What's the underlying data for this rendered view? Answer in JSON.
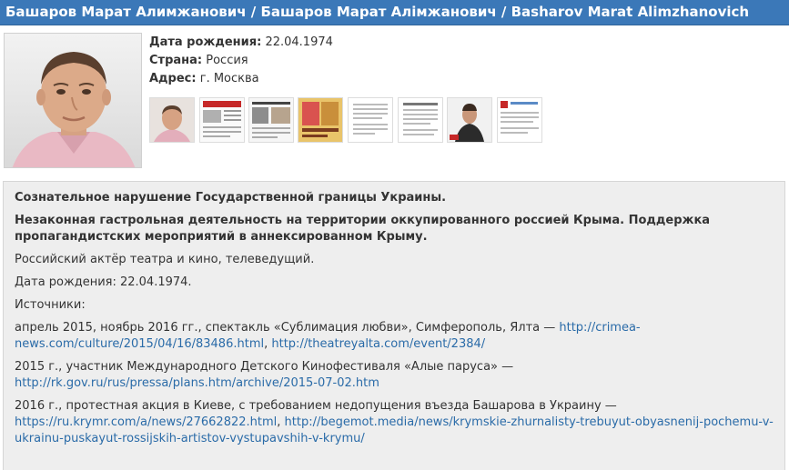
{
  "header": {
    "title": "Башаров Марат Алимжанович / Башаров Марат Алімжанович / Basharov Marat Alimzhanovich"
  },
  "profile": {
    "birth_label": "Дата рождения:",
    "birth_value": "22.04.1974",
    "country_label": "Страна:",
    "country_value": "Россия",
    "address_label": "Адрес:",
    "address_value": "г. Москва"
  },
  "thumbnails_count": 8,
  "details": {
    "violation": "Сознательное нарушение Государственной границы Украины.",
    "activity": "Незаконная гастрольная деятельность на территории оккупированного россией Крыма. Поддержка пропагандистских мероприятий в аннексированном Крыму.",
    "description": "Российский актёр театра и кино, телеведущий.",
    "birth": "Дата рождения: 22.04.1974.",
    "sources_label": "Источники:",
    "source1_text": "апрель 2015, ноябрь 2016 гг., спектакль «Сублимация любви», Симферополь, Ялта — ",
    "source1_link1": "http://crimea-news.com/culture/2015/04/16/83486.html",
    "source1_sep": ", ",
    "source1_link2": "http://theatreyalta.com/event/2384/",
    "source2_text": "2015 г., участник Международного Детского Кинофестиваля «Алые паруса» — ",
    "source2_link1": "http://rk.gov.ru/rus/pressa/plans.htm/archive/2015-07-02.htm",
    "source3_text": "2016 г., протестная акция в Киеве, с требованием недопущения въезда Башарова в Украину — ",
    "source3_link1": "https://ru.krymr.com/a/news/27662822.html",
    "source3_sep": ", ",
    "source3_link2": "http://begemot.media/news/krymskie-zhurnalisty-trebuyut-obyasnenij-pochemu-v-ukrainu-puskayut-rossijskih-artistov-vystupavshih-v-krymu/"
  }
}
